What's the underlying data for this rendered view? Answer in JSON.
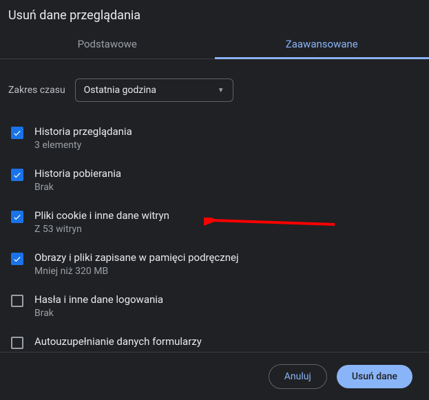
{
  "dialog": {
    "title": "Usuń dane przeglądania",
    "tabs": {
      "basic": "Podstawowe",
      "advanced": "Zaawansowane"
    },
    "time_range": {
      "label": "Zakres czasu",
      "selected": "Ostatnia godzina"
    },
    "items": [
      {
        "title": "Historia przeglądania",
        "sub": "3 elementy",
        "checked": true
      },
      {
        "title": "Historia pobierania",
        "sub": "Brak",
        "checked": true
      },
      {
        "title": "Pliki cookie i inne dane witryn",
        "sub": "Z 53 witryn",
        "checked": true
      },
      {
        "title": "Obrazy i pliki zapisane w pamięci podręcznej",
        "sub": "Mniej niż 320 MB",
        "checked": true
      },
      {
        "title": "Hasła i inne dane logowania",
        "sub": "Brak",
        "checked": false
      },
      {
        "title": "Autouzupełnianie danych formularzy",
        "sub": "",
        "checked": false
      }
    ],
    "buttons": {
      "cancel": "Anuluj",
      "confirm": "Usuń dane"
    },
    "annotation": {
      "arrow_color": "#ff0000",
      "points_to_item_index": 2
    }
  }
}
